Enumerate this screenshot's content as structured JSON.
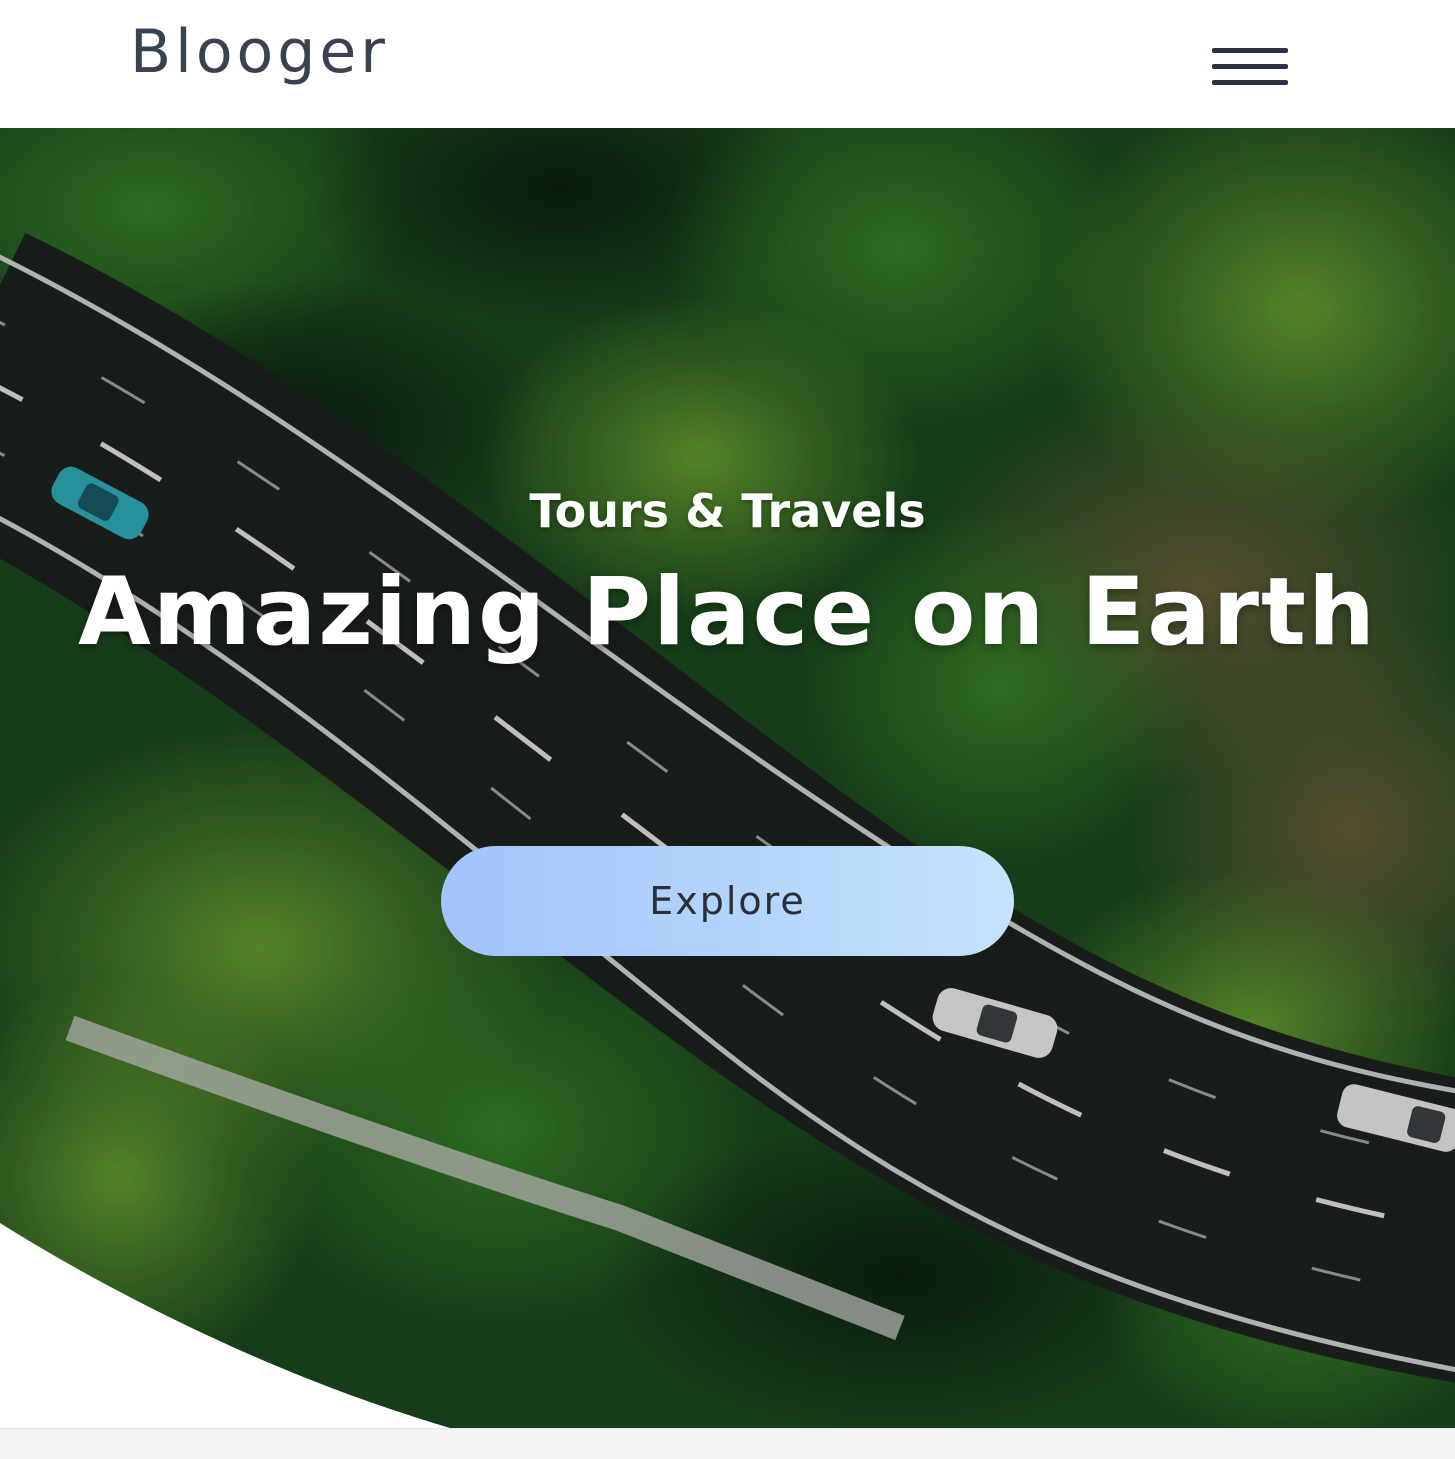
{
  "header": {
    "brand": "Blooger",
    "menu_icon": "hamburger-menu-icon"
  },
  "hero": {
    "subtitle": "Tours & Travels",
    "title": "Amazing Place on Earth",
    "cta_label": "Explore",
    "colors": {
      "forest_dark": "#0f2a16",
      "forest_mid": "#2e6b26",
      "forest_light": "#6fa832",
      "road": "#1e2420",
      "cta_gradient_start": "#a2c3fb",
      "cta_gradient_end": "#c6e3fb"
    }
  }
}
